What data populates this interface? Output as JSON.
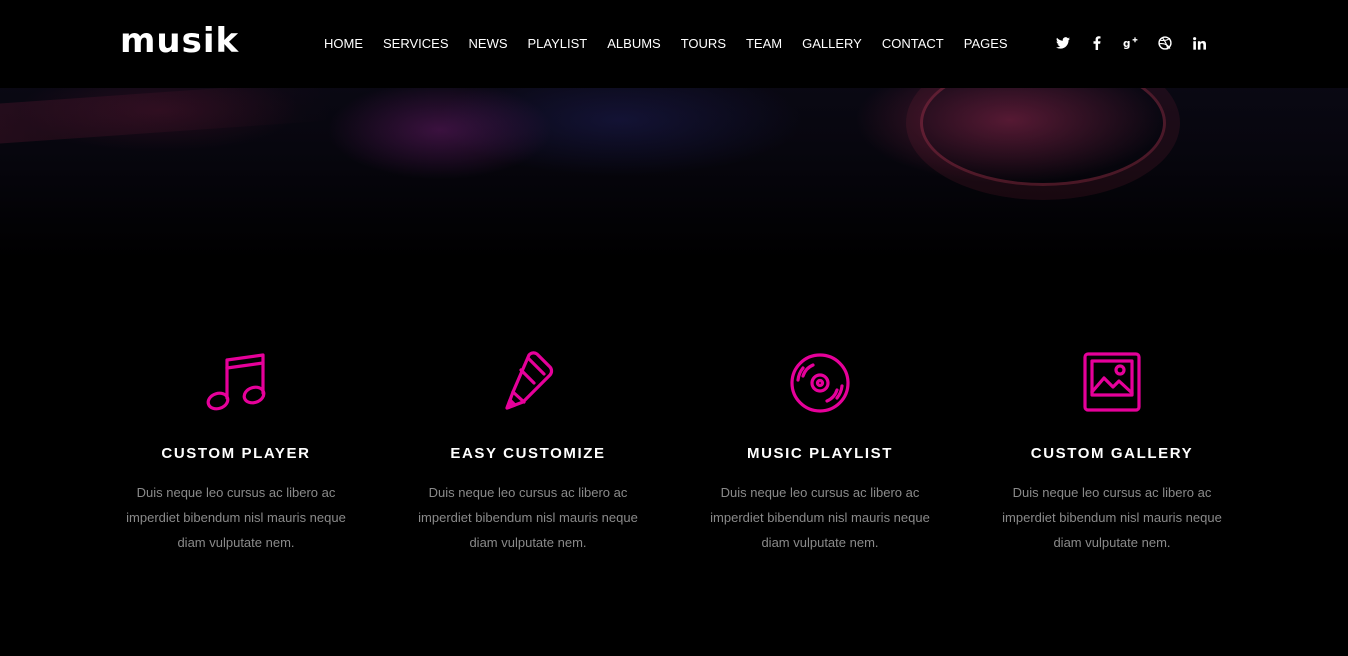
{
  "brand": {
    "logo_text": "musik"
  },
  "nav": {
    "items": [
      "HOME",
      "SERVICES",
      "NEWS",
      "PLAYLIST",
      "ALBUMS",
      "TOURS",
      "TEAM",
      "GALLERY",
      "CONTACT",
      "PAGES"
    ]
  },
  "social": {
    "items": [
      {
        "icon": "twitter-icon",
        "glyph": "🐦"
      },
      {
        "icon": "facebook-icon",
        "glyph": "f"
      },
      {
        "icon": "google-plus-icon",
        "glyph": "g+"
      },
      {
        "icon": "dribbble-icon",
        "glyph": "◎"
      },
      {
        "icon": "linkedin-icon",
        "glyph": "in"
      }
    ]
  },
  "colors": {
    "accent": "#e6009a",
    "background": "#000000",
    "body_text": "#8a8a8a"
  },
  "features": [
    {
      "icon": "music-note-icon",
      "title": "CUSTOM PLAYER",
      "text": "Duis neque leo cursus ac libero ac imperdiet bibendum nisl mauris neque diam vulputate nem."
    },
    {
      "icon": "pencil-icon",
      "title": "EASY CUSTOMIZE",
      "text": "Duis neque leo cursus ac libero ac imperdiet bibendum nisl mauris neque diam vulputate nem."
    },
    {
      "icon": "vinyl-disc-icon",
      "title": "MUSIC PLAYLIST",
      "text": "Duis neque leo cursus ac libero ac imperdiet bibendum nisl mauris neque diam vulputate nem."
    },
    {
      "icon": "image-gallery-icon",
      "title": "CUSTOM GALLERY",
      "text": "Duis neque leo cursus ac libero ac imperdiet bibendum nisl mauris neque diam vulputate nem."
    }
  ]
}
